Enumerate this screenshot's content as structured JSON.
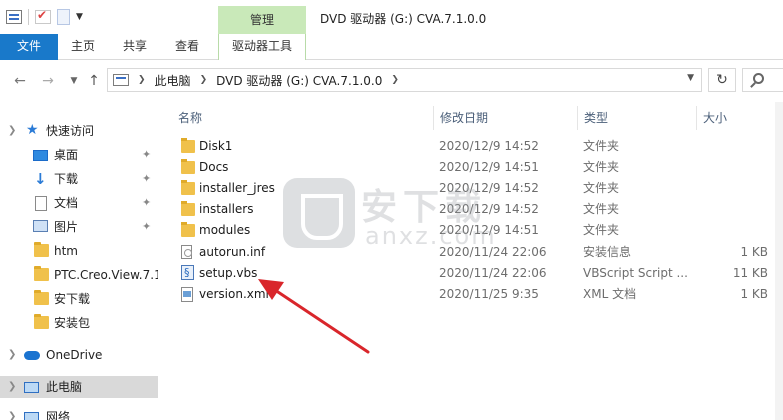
{
  "window": {
    "title": "DVD 驱动器 (G:) CVA.7.1.0.0",
    "context_group": "管理"
  },
  "ribbon": {
    "tabs": [
      "文件",
      "主页",
      "共享",
      "查看",
      "驱动器工具"
    ]
  },
  "address_bar": {
    "crumbs": [
      "此电脑",
      "DVD 驱动器 (G:) CVA.7.1.0.0"
    ]
  },
  "nav_pane": {
    "items": [
      {
        "label": "快速访问",
        "icon": "star-icon",
        "pinned": false
      },
      {
        "label": "桌面",
        "icon": "desktop-icon",
        "pinned": true
      },
      {
        "label": "下载",
        "icon": "download-icon",
        "pinned": true
      },
      {
        "label": "文档",
        "icon": "documents-icon",
        "pinned": true
      },
      {
        "label": "图片",
        "icon": "pictures-icon",
        "pinned": true
      },
      {
        "label": "htm",
        "icon": "folder-icon",
        "pinned": false
      },
      {
        "label": "PTC.Creo.View.7.1",
        "icon": "folder-icon",
        "pinned": false
      },
      {
        "label": "安下载",
        "icon": "folder-icon",
        "pinned": false
      },
      {
        "label": "安装包",
        "icon": "folder-icon",
        "pinned": false
      },
      {
        "label": "OneDrive",
        "icon": "cloud-icon",
        "pinned": false
      },
      {
        "label": "此电脑",
        "icon": "pc-icon",
        "pinned": false
      },
      {
        "label": "网络",
        "icon": "network-icon",
        "pinned": false
      }
    ]
  },
  "content": {
    "columns": {
      "name": "名称",
      "date": "修改日期",
      "type": "类型",
      "size": "大小"
    },
    "files": [
      {
        "name": "Disk1",
        "date": "2020/12/9 14:52",
        "type": "文件夹",
        "size": "",
        "icon": "folder"
      },
      {
        "name": "Docs",
        "date": "2020/12/9 14:51",
        "type": "文件夹",
        "size": "",
        "icon": "folder"
      },
      {
        "name": "installer_jres",
        "date": "2020/12/9 14:52",
        "type": "文件夹",
        "size": "",
        "icon": "folder"
      },
      {
        "name": "installers",
        "date": "2020/12/9 14:52",
        "type": "文件夹",
        "size": "",
        "icon": "folder"
      },
      {
        "name": "modules",
        "date": "2020/12/9 14:51",
        "type": "文件夹",
        "size": "",
        "icon": "folder"
      },
      {
        "name": "autorun.inf",
        "date": "2020/11/24 22:06",
        "type": "安装信息",
        "size": "1 KB",
        "icon": "inf"
      },
      {
        "name": "setup.vbs",
        "date": "2020/11/24 22:06",
        "type": "VBScript Script ...",
        "size": "11 KB",
        "icon": "vbs"
      },
      {
        "name": "version.xml",
        "date": "2020/11/25 9:35",
        "type": "XML 文档",
        "size": "1 KB",
        "icon": "xml"
      }
    ]
  },
  "watermark": {
    "main": "安下载",
    "sub": "anxz.com"
  },
  "colors": {
    "file_tab": "#1979ca",
    "manage_tab": "#c9e9b9",
    "arrow": "#d9262b",
    "selected": "#d9d9d9"
  }
}
